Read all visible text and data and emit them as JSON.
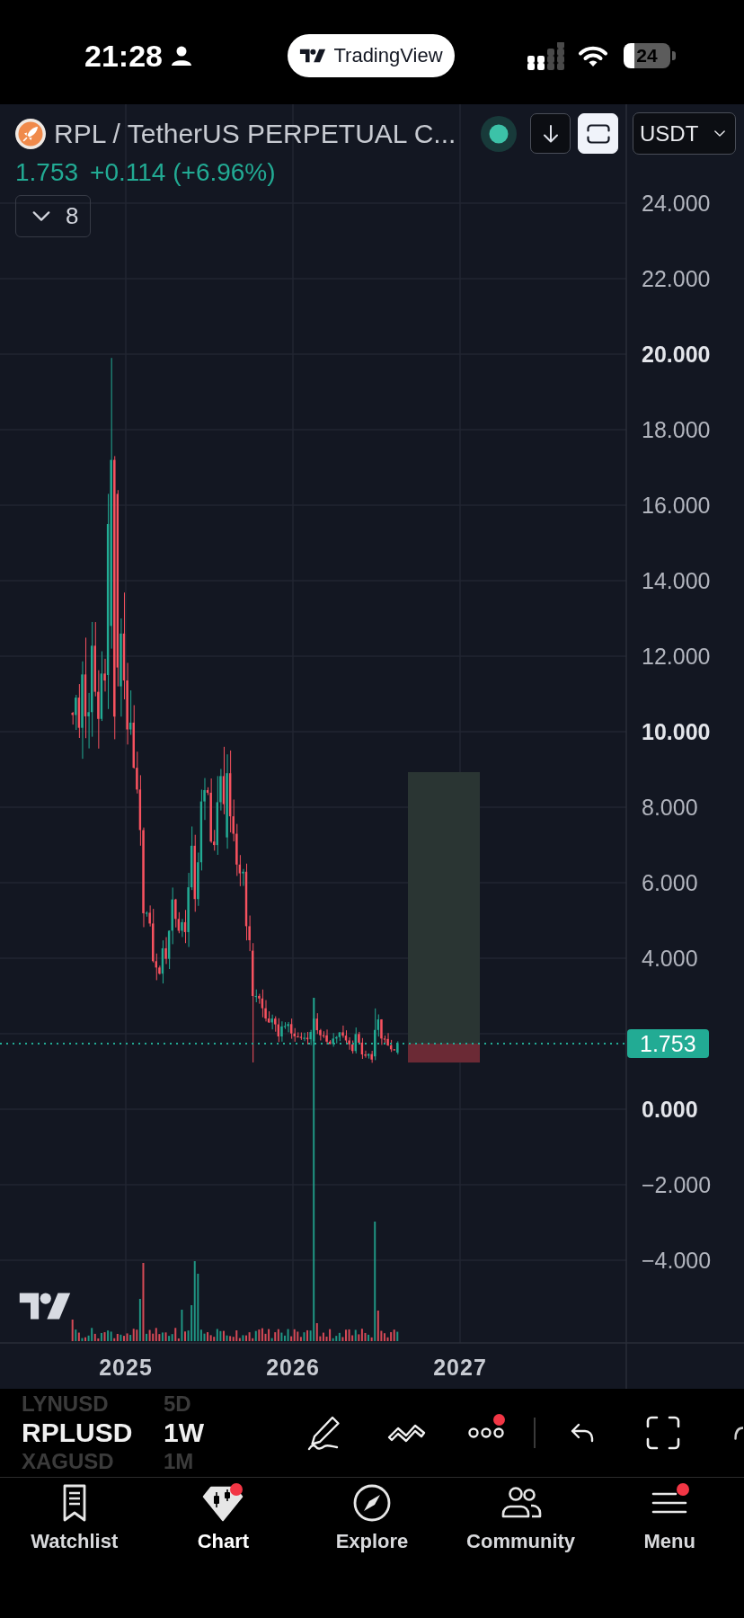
{
  "status_bar": {
    "time": "21:28",
    "app_pill": "TradingView",
    "battery": "24"
  },
  "chart": {
    "symbol": {
      "title": "RPL / TetherUS PERPETUAL C...",
      "market_open": true
    },
    "header_buttons": [
      {
        "kind": "download",
        "on": false
      },
      {
        "kind": "frame",
        "on": true
      }
    ],
    "currency": "USDT",
    "quote": {
      "price": "1.753",
      "change": "+0.114 (+6.96%)"
    },
    "indicators_button": "8",
    "price_axis": [
      {
        "label": "24.000",
        "major": false
      },
      {
        "label": "22.000",
        "major": false
      },
      {
        "label": "20.000",
        "major": true
      },
      {
        "label": "18.000",
        "major": false
      },
      {
        "label": "16.000",
        "major": false
      },
      {
        "label": "14.000",
        "major": false
      },
      {
        "label": "12.000",
        "major": false
      },
      {
        "label": "10.000",
        "major": true
      },
      {
        "label": "8.000",
        "major": false
      },
      {
        "label": "6.000",
        "major": false
      },
      {
        "label": "4.000",
        "major": false
      },
      {
        "label": "0.000",
        "major": true
      },
      {
        "label": "−2.000",
        "major": false
      },
      {
        "label": "−4.000",
        "major": false
      }
    ],
    "last_price_tag": "1.753",
    "time_axis": [
      "2025",
      "2026",
      "2027"
    ]
  },
  "bottom_toolbar": {
    "symbols": [
      {
        "label": "LYNUSD",
        "selected": false
      },
      {
        "label": "RPLUSD",
        "selected": true
      },
      {
        "label": "XAGUSD",
        "selected": false
      }
    ],
    "intervals": [
      {
        "label": "5D",
        "selected": false
      },
      {
        "label": "1W",
        "selected": true
      },
      {
        "label": "1M",
        "selected": false
      }
    ],
    "tools": [
      {
        "kind": "draw",
        "notification": false
      },
      {
        "kind": "trend",
        "notification": false
      },
      {
        "kind": "more",
        "notification": true
      },
      {
        "kind": "undo",
        "notification": false
      },
      {
        "kind": "fullscreen",
        "notification": false
      },
      {
        "kind": "redo",
        "notification": false
      }
    ]
  },
  "tab_bar": [
    {
      "label": "Watchlist",
      "selected": false,
      "notification": false
    },
    {
      "label": "Chart",
      "selected": true,
      "notification": true
    },
    {
      "label": "Explore",
      "selected": false,
      "notification": false
    },
    {
      "label": "Community",
      "selected": false,
      "notification": false
    },
    {
      "label": "Menu",
      "selected": false,
      "notification": true
    }
  ]
}
